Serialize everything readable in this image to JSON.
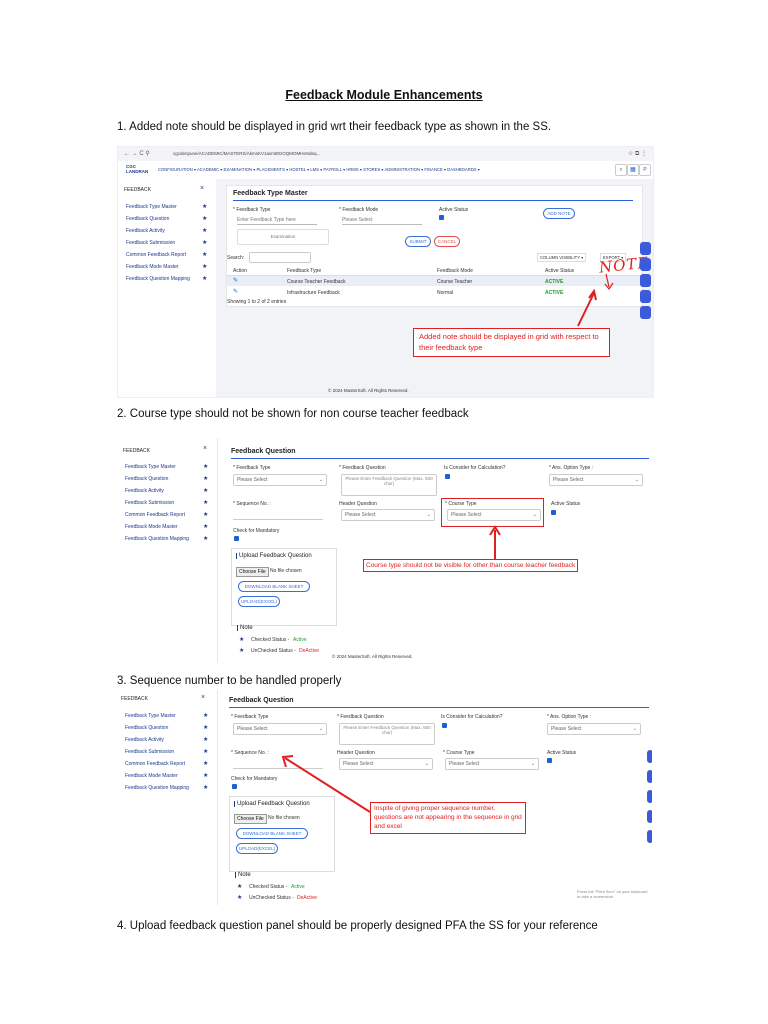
{
  "doc": {
    "title": "Feedback Module Enhancements",
    "point1": "1. Added note should be displayed in grid wrt their feedback type as shown in the SS.",
    "point2": "2. Course type should not be shown for non course teacher feedback",
    "point3": "3. Sequence number to be handled properly",
    "point4": "4. Upload feedback question panel should be properly designed PFA the SS for your reference"
  },
  "sidebar": {
    "title": "FEEDBACK",
    "items": [
      "Feedback Type Master",
      "Feedback Question",
      "Feedback Activity",
      "Feedback Submission",
      "Common Feedback Report",
      "Feedback Mode Master",
      "Feedback Question Mapping"
    ]
  },
  "shot1": {
    "url": "cgcdenpune/ACADEMIC/MASTERS/AkmsKV1asm80zOQMOMHeSdeq...",
    "nav": "CONFIGURATION ▾  ACADEMIC ▾  EXAMINATION ▾  PLACEMENTS ▾  HOSTEL ▾  LMS ▾  PAYROLL ▾  HRMS ▾  STORES ▾  ADMINISTRATION ▾  FINANCE ▾  DASHBOARDS ▾",
    "logo": "CGC LANDRAN",
    "panel_title": "Feedback Type Master",
    "feedback_type_label": "* Feedback Type",
    "feedback_type_placeholder": "Enter Feedback Type here",
    "feedback_mode_label": "* Feedback Mode",
    "feedback_mode_value": "Please Select",
    "active_status_label": "Active Status",
    "add_note": "ADD NOTE",
    "examination": "Examination",
    "submit": "SUBMIT",
    "cancel": "CANCEL",
    "search": "Search:",
    "column_visibility": "COLUMN VISIBILITY ▾",
    "export": "EXPORT ▾",
    "columns": [
      "Action",
      "Feedback Type",
      "Feedback Mode",
      "Active Status"
    ],
    "rows": [
      {
        "type": "Course Teacher Feedback",
        "mode": "Course Teacher",
        "status": "ACTIVE"
      },
      {
        "type": "Infrastructure Feedback",
        "mode": "Normal",
        "status": "ACTIVE"
      }
    ],
    "showing": "Showing 1 to 2 of 2 entries",
    "footer": "© 2024 MasterSoft. All Rights Reserved.",
    "handwritten": "NOTE",
    "annotation": "Added note should be displayed in grid with respect to their feedback type"
  },
  "form": {
    "panel_title": "Feedback Question",
    "feedback_type_label": "* Feedback Type",
    "feedback_type_value": "Please Select",
    "feedback_question_label": "* Feedback Question",
    "feedback_question_placeholder": "Please Enter Feedback Question (Max. 500 char)",
    "consider_label": "Is Consider for Calculation?",
    "ans_option_label": "* Ans. Option Type :",
    "ans_option_value": "Please Select",
    "sequence_label": "* Sequence No. :",
    "header_question_label": "Header Question",
    "header_question_value": "Please Select",
    "course_type_label": "* Course Type",
    "course_type_value": "Please Select",
    "active_status_label": "Active Status",
    "check_mandatory_label": "Check for Mandatory",
    "upload_title": "Upload Feedback Question",
    "choose_file": "Choose File",
    "no_file": "No file chosen",
    "download_blank": "DOWNLOAD BLANK SHEET",
    "upload_excel": "UPLOAD(EXCEL)",
    "note_title": "Note",
    "checked_status": "Checked Status - ",
    "checked_value": "Active",
    "unchecked_status": "UnChecked Status - ",
    "unchecked_value": "DeActive",
    "footer": "© 2024 MasterSoft. All Rights Reserved.",
    "print_hint": "Press the \"Print Scrn\" on your keyboard to take a screenshot"
  },
  "annotations": {
    "shot2": "Course type should not be visible for other than course teacher feedback",
    "shot3": "Inspite of giving proper sequence number, questions are not appearing in the sequence in grid and excel"
  },
  "colors": {
    "accent": "#1e5fd6",
    "nav": "#1a3a8a",
    "annotation": "#e02020",
    "active_green": "#1a9c2a"
  }
}
